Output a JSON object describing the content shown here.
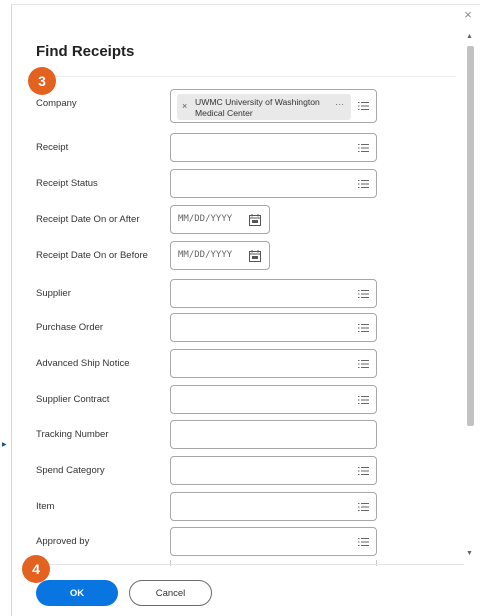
{
  "dialog": {
    "title": "Find Receipts",
    "close_glyph": "×"
  },
  "steps": {
    "step_3": "3",
    "step_4": "4"
  },
  "company_selection": {
    "remove_glyph": "×",
    "value": "UWMC University of Washington Medical Center",
    "more_glyph": "···"
  },
  "fields": [
    {
      "label": "Company",
      "kind": "multiselect"
    },
    {
      "label": "Receipt",
      "kind": "prompt"
    },
    {
      "label": "Receipt Status",
      "kind": "prompt"
    },
    {
      "label": "Receipt Date On or After",
      "kind": "date",
      "placeholder": "MM/DD/YYYY"
    },
    {
      "label": "Receipt Date On or Before",
      "kind": "date",
      "placeholder": "MM/DD/YYYY"
    },
    {
      "label": "Supplier",
      "kind": "prompt"
    },
    {
      "label": "Purchase Order",
      "kind": "prompt"
    },
    {
      "label": "Advanced Ship Notice",
      "kind": "prompt"
    },
    {
      "label": "Supplier Contract",
      "kind": "prompt"
    },
    {
      "label": "Tracking Number",
      "kind": "text"
    },
    {
      "label": "Spend Category",
      "kind": "prompt"
    },
    {
      "label": "Item",
      "kind": "prompt"
    },
    {
      "label": "Approved by",
      "kind": "prompt"
    }
  ],
  "buttons": {
    "ok": "OK",
    "cancel": "Cancel"
  },
  "scroll": {
    "up_glyph": "▲",
    "down_glyph": "▼"
  },
  "colors": {
    "primary_button": "#0875e1",
    "step_badge": "#e4621f",
    "field_border": "#a7a7a7",
    "chip_background": "#e9e9e9"
  },
  "icons": {
    "prompt": "list-prompt-icon",
    "date": "calendar-icon",
    "close": "close-icon"
  }
}
